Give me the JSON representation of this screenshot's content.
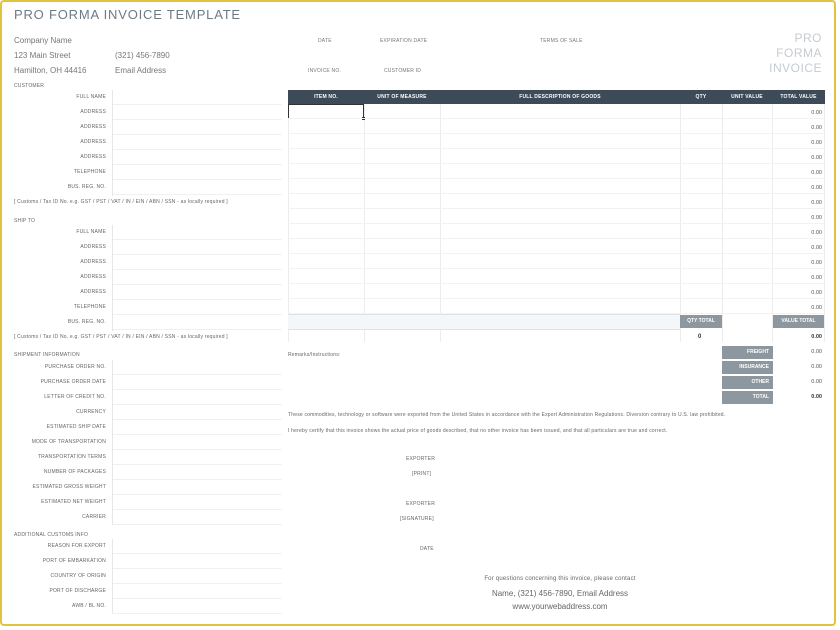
{
  "title": "PRO FORMA INVOICE TEMPLATE",
  "company": {
    "name": "Company Name",
    "street": "123 Main Street",
    "city": "Hamilton, OH  44416",
    "phone": "(321) 456-7890",
    "email": "Email Address"
  },
  "header_fields": {
    "date": "DATE",
    "expiration_date": "EXPIRATION DATE",
    "terms_of_sale": "TERMS OF SALE",
    "invoice_no": "INVOICE NO.",
    "customer_id": "CUSTOMER ID"
  },
  "big_label": [
    "PRO",
    "FORMA",
    "INVOICE"
  ],
  "customer": {
    "heading": "CUSTOMER",
    "fields": [
      "FULL NAME",
      "ADDRESS",
      "ADDRESS",
      "ADDRESS",
      "ADDRESS",
      "TELEPHONE",
      "BUS. REG. NO."
    ],
    "note": "[ Customs / Tax ID No. e.g. GST / PST / VAT / IN / EIN / ABN / SSN - as locally required ]"
  },
  "ship_to": {
    "heading": "SHIP TO",
    "fields": [
      "FULL NAME",
      "ADDRESS",
      "ADDRESS",
      "ADDRESS",
      "ADDRESS",
      "TELEPHONE",
      "BUS. REG. NO."
    ],
    "note": "[ Customs / Tax ID No. e.g. GST / PST / VAT / IN / EIN / ABN / SSN - as locally required ]"
  },
  "shipment": {
    "heading": "SHIPMENT INFORMATION",
    "fields": [
      "PURCHASE ORDER NO.",
      "PURCHASE ORDER DATE",
      "LETTER OF CREDIT NO.",
      "CURRENCY",
      "ESTIMATED SHIP DATE",
      "MODE OF TRANSPORTATION",
      "TRANSPORTATION TERMS",
      "NUMBER OF PACKAGES",
      "ESTIMATED GROSS WEIGHT",
      "ESTIMATED NET WEIGHT",
      "CARRIER"
    ]
  },
  "additional": {
    "heading": "ADDITIONAL CUSTOMS INFO",
    "fields": [
      "REASON FOR EXPORT",
      "PORT OF EMBARKATION",
      "COUNTRY OF ORIGIN",
      "PORT OF DISCHARGE",
      "AWB / BL NO."
    ]
  },
  "table": {
    "headers": [
      "ITEM NO.",
      "UNIT OF MEASURE",
      "FULL DESCRIPTION OF GOODS",
      "QTY",
      "UNIT VALUE",
      "TOTAL VALUE"
    ],
    "row_totals": [
      "0.00",
      "0.00",
      "0.00",
      "0.00",
      "0.00",
      "0.00",
      "0.00",
      "0.00",
      "0.00",
      "0.00",
      "0.00",
      "0.00",
      "0.00",
      "0.00"
    ],
    "qty_total_label": "QTY TOTAL",
    "value_total_label": "VALUE TOTAL",
    "qty_total": "0",
    "value_total": "0.00"
  },
  "totals": {
    "remarks": "Remarks/Instructions:",
    "freight_label": "FREIGHT",
    "freight": "0.00",
    "insurance_label": "INSURANCE",
    "insurance": "0.00",
    "other_label": "OTHER",
    "other": "0.00",
    "total_label": "TOTAL",
    "total": "0.00"
  },
  "declarations": {
    "line1": "These commodities, technology or software were exported from the United States in accordance with the Export Administration Regulations.  Diversion contrary to U.S. law prohibited.",
    "line2": "I hereby certify that this invoice shows the actual price of goods described, that no other invoice has been issued, and that all particulars are true and correct."
  },
  "signatures": {
    "exporter1": "EXPORTER",
    "print": "[PRINT]",
    "exporter2": "EXPORTER",
    "signature": "[SIGNATURE]",
    "date": "DATE"
  },
  "contact": {
    "line1": "For questions concerning this invoice, please contact",
    "line2": "Name, (321) 456-7890, Email Address",
    "line3": "www.yourwebaddress.com"
  }
}
